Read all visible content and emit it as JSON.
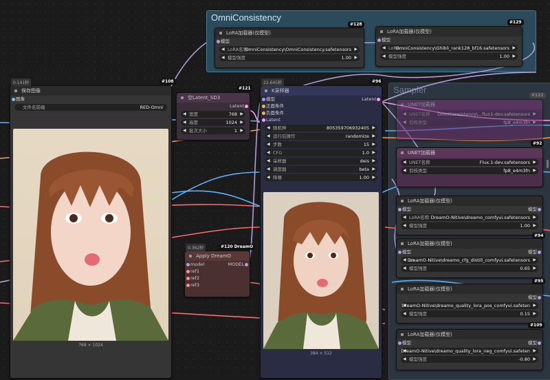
{
  "groups": {
    "omni": {
      "title": "OmniConsistency",
      "color": "#2b4a5c"
    },
    "sampler": {
      "title": "Sampler",
      "color": "#3a4a5a"
    }
  },
  "nodes": {
    "lora128": {
      "title": "LoRA加载器(仅模型)",
      "id": "#128",
      "in_model": "模型",
      "out_model": "模型",
      "w_name_label": "LoRA名称",
      "w_name_value": "OmniConsistency\\OmniConsistency.safetensors",
      "w_strength_label": "模型强度",
      "w_strength_value": "1.00"
    },
    "lora129": {
      "title": "LoRA加载器(仅模型)",
      "id": "#129",
      "in_model": "模型",
      "out_model": "模型",
      "w_name_label": "LoRA ...",
      "w_name_value": "OmniConsistency\\Ghibli_rank128_bf16.safetensors",
      "w_strength_label": "模型强度",
      "w_strength_value": "1.00"
    },
    "save108": {
      "timing": "0.141秒",
      "title": "保存图像",
      "id": "#108",
      "in_image": "图像",
      "w_prefix_label": "文件名前缀",
      "w_prefix_value": "RED-Omni",
      "image_size": "768 × 1024"
    },
    "latent121": {
      "title": "空Latent_SD3",
      "id": "#121",
      "out_latent": "Latent",
      "w_width_label": "宽度",
      "w_width_value": "768",
      "w_height_label": "高度",
      "w_height_value": "1024",
      "w_batch_label": "批次大小",
      "w_batch_value": "1"
    },
    "ksampler96": {
      "timing": "22.645秒",
      "title": "K采样器",
      "id": "#96",
      "in_model": "模型",
      "in_pos": "正面条件",
      "in_neg": "负面条件",
      "in_latent": "Latent",
      "out_latent": "Latent",
      "widgets": [
        {
          "label": "随机种",
          "value": "805359706932405"
        },
        {
          "label": "运行后操作",
          "value": "randomize"
        },
        {
          "label": "步数",
          "value": "15"
        },
        {
          "label": "CFG",
          "value": "1.0"
        },
        {
          "label": "采样器",
          "value": "deis"
        },
        {
          "label": "调度器",
          "value": "beta"
        },
        {
          "label": "降噪",
          "value": "1.00"
        }
      ],
      "image_size": "384 × 512"
    },
    "dreamo120": {
      "timing": "0.362秒",
      "title": "Apply DreamO",
      "id": "#120 DreamO",
      "in_model": "model",
      "in_ref1": "ref1",
      "in_ref2": "ref2",
      "in_ref3": "ref3",
      "out_model": "MODEL"
    },
    "unet_faded": {
      "title": "UNET加载器",
      "id": "#122",
      "w1_label": "UNET名称",
      "w1_value": "OmniConsistency\\...flux1-dev.safetensors",
      "w2_label": "剪枝类型",
      "w2_value": "fp8_e4m3fn"
    },
    "unet92": {
      "title": "UNET加载器",
      "id": "#92",
      "w1_label": "UNET名称",
      "w1_value": "Flux.1-dev.safetensors",
      "w2_label": "剪枝类型",
      "w2_value": "fp8_e4m3fn"
    },
    "lora_dreamo1": {
      "title": "LoRA加载器(仅模型)",
      "in_model": "模型",
      "out_model": "模型",
      "w_name_label": "LoRA名称",
      "w_name_value": "DreamO-Nitive\\dreamo_comfyui.safetensors",
      "w_strength_label": "模型强度",
      "w_strength_value": "1.00"
    },
    "lora94": {
      "title": "LoRA加载器(仅模型)",
      "id": "#94",
      "in_model": "模型",
      "out_model": "模型",
      "w_name_label": "Lo...",
      "w_name_value": "DreamO-Nitive\\dreamo_cfg_distill_comfyui.safetensors",
      "w_strength_label": "模型强度",
      "w_strength_value": "0.65"
    },
    "lora95": {
      "title": "LoRA加载器(仅模型)",
      "id": "#95",
      "in_model": "模型",
      "out_model": "模型",
      "w_name_value": "DreamO-Nitive\\dreamo_quality_lora_pos_comfyui.safeten",
      "w_strength_label": "模型强度",
      "w_strength_value": "0.15"
    },
    "lora109": {
      "title": "LoRA加载器(仅模型)",
      "id": "#109",
      "in_model": "模型",
      "out_model": "模型",
      "w_name_value": "DreamO-Nitive\\dreamo_quality_lora_neg_comfyui.safeten",
      "w_strength_label": "模型强度",
      "w_strength_value": "-0.80"
    }
  },
  "colors": {
    "accent_model": "#b39ddb",
    "accent_latent": "#ff9cf9",
    "accent_purple_node": "#4a2e4a",
    "dreamo_node": "#4a3030"
  }
}
